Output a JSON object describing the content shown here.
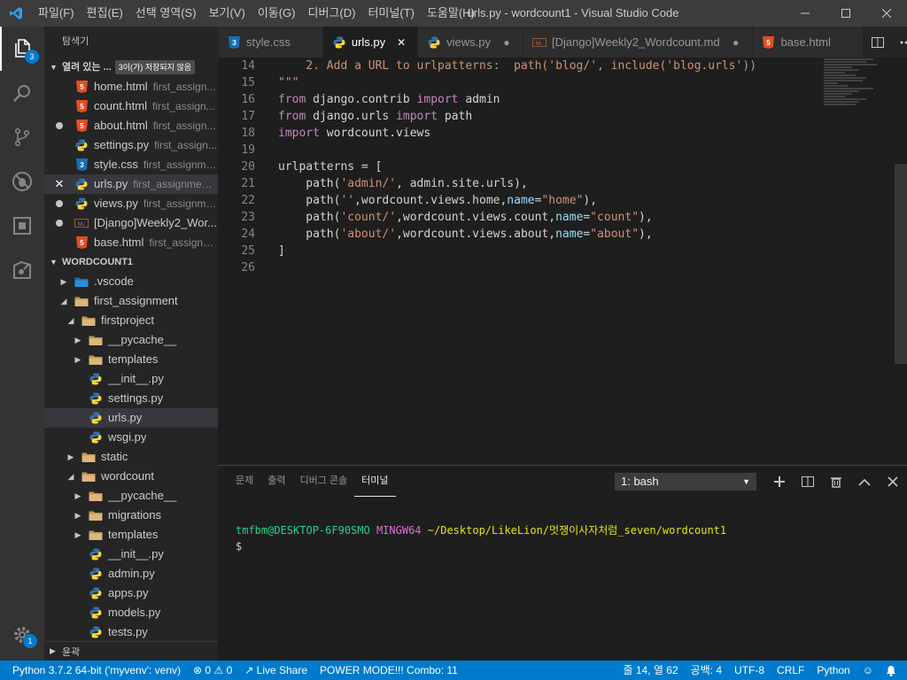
{
  "window": {
    "title": "urls.py - wordcount1 - Visual Studio Code"
  },
  "menu": [
    "파일(F)",
    "편집(E)",
    "선택 영역(S)",
    "보기(V)",
    "이동(G)",
    "디버그(D)",
    "터미널(T)",
    "도움말(H)"
  ],
  "activity": {
    "explorer_badge": "3",
    "settings_badge": "1"
  },
  "sidebar": {
    "title": "탐색기",
    "open_editors": {
      "header": "열려 있는 ...",
      "unsaved": "3이(가) 저장되지 않음",
      "items": [
        {
          "name": "home.html",
          "desc": "first_assign...",
          "icon": "html",
          "status": ""
        },
        {
          "name": "count.html",
          "desc": "first_assign...",
          "icon": "html",
          "status": ""
        },
        {
          "name": "about.html",
          "desc": "first_assign...",
          "icon": "html",
          "status": "dirty"
        },
        {
          "name": "settings.py",
          "desc": "first_assign...",
          "icon": "python",
          "status": ""
        },
        {
          "name": "style.css",
          "desc": "first_assignme...",
          "icon": "css",
          "status": ""
        },
        {
          "name": "urls.py",
          "desc": "first_assignment...",
          "icon": "python",
          "status": "close"
        },
        {
          "name": "views.py",
          "desc": "first_assignme...",
          "icon": "python",
          "status": "dirty"
        },
        {
          "name": "[Django]Weekly2_Wor...",
          "desc": "",
          "icon": "markdown",
          "status": "dirty"
        },
        {
          "name": "base.html",
          "desc": "first_assignm...",
          "icon": "html",
          "status": ""
        }
      ]
    },
    "workspace": {
      "header": "WORDCOUNT1",
      "items": [
        {
          "name": ".vscode",
          "kind": "folder-vscode",
          "depth": 0,
          "chev": "closed"
        },
        {
          "name": "first_assignment",
          "kind": "folder",
          "depth": 0,
          "chev": "open"
        },
        {
          "name": "firstproject",
          "kind": "folder",
          "depth": 1,
          "chev": "open"
        },
        {
          "name": "__pycache__",
          "kind": "folder",
          "depth": 2,
          "chev": "closed"
        },
        {
          "name": "templates",
          "kind": "folder",
          "depth": 2,
          "chev": "closed"
        },
        {
          "name": "__init__.py",
          "kind": "python",
          "depth": 2,
          "chev": ""
        },
        {
          "name": "settings.py",
          "kind": "python",
          "depth": 2,
          "chev": ""
        },
        {
          "name": "urls.py",
          "kind": "python",
          "depth": 2,
          "chev": "",
          "selected": true
        },
        {
          "name": "wsgi.py",
          "kind": "python",
          "depth": 2,
          "chev": ""
        },
        {
          "name": "static",
          "kind": "folder",
          "depth": 1,
          "chev": "closed"
        },
        {
          "name": "wordcount",
          "kind": "folder",
          "depth": 1,
          "chev": "open"
        },
        {
          "name": "__pycache__",
          "kind": "folder",
          "depth": 2,
          "chev": "closed"
        },
        {
          "name": "migrations",
          "kind": "folder",
          "depth": 2,
          "chev": "closed"
        },
        {
          "name": "templates",
          "kind": "folder",
          "depth": 2,
          "chev": "closed"
        },
        {
          "name": "__init__.py",
          "kind": "python",
          "depth": 2,
          "chev": ""
        },
        {
          "name": "admin.py",
          "kind": "python",
          "depth": 2,
          "chev": ""
        },
        {
          "name": "apps.py",
          "kind": "python",
          "depth": 2,
          "chev": ""
        },
        {
          "name": "models.py",
          "kind": "python",
          "depth": 2,
          "chev": ""
        },
        {
          "name": "tests.py",
          "kind": "python",
          "depth": 2,
          "chev": ""
        }
      ]
    },
    "outline": "윤곽"
  },
  "tabs": [
    {
      "label": "style.css",
      "icon": "css",
      "state": ""
    },
    {
      "label": "urls.py",
      "icon": "python",
      "state": "active"
    },
    {
      "label": "views.py",
      "icon": "python",
      "state": "dirty"
    },
    {
      "label": "[Django]Weekly2_Wordcount.md",
      "icon": "markdown",
      "state": "dirty"
    },
    {
      "label": "base.html",
      "icon": "html",
      "state": ""
    }
  ],
  "editor": {
    "lines": [
      {
        "n": "14",
        "tokens": [
          [
            "cmt",
            "    2. Add a URL to urlpatterns:  path('blog/', include('blog.urls'))"
          ]
        ]
      },
      {
        "n": "15",
        "tokens": [
          [
            "cmt",
            "\"\"\""
          ]
        ]
      },
      {
        "n": "16",
        "tokens": [
          [
            "kw",
            "from"
          ],
          [
            "",
            " django.contrib "
          ],
          [
            "kw",
            "import"
          ],
          [
            "",
            " admin"
          ]
        ]
      },
      {
        "n": "17",
        "tokens": [
          [
            "kw",
            "from"
          ],
          [
            "",
            " django.urls "
          ],
          [
            "kw",
            "import"
          ],
          [
            "",
            " path"
          ]
        ]
      },
      {
        "n": "18",
        "tokens": [
          [
            "kw",
            "import"
          ],
          [
            "",
            " wordcount.views"
          ]
        ]
      },
      {
        "n": "19",
        "tokens": []
      },
      {
        "n": "20",
        "tokens": [
          [
            "",
            "urlpatterns = ["
          ]
        ]
      },
      {
        "n": "21",
        "tokens": [
          [
            "",
            "    path("
          ],
          [
            "str",
            "'admin/'"
          ],
          [
            "",
            ", admin.site.urls),"
          ]
        ]
      },
      {
        "n": "22",
        "tokens": [
          [
            "",
            "    path("
          ],
          [
            "str",
            "''"
          ],
          [
            "",
            ",wordcount.views.home,"
          ],
          [
            "prm",
            "name"
          ],
          [
            "",
            "="
          ],
          [
            "str",
            "\"home\""
          ],
          [
            "",
            "),"
          ]
        ]
      },
      {
        "n": "23",
        "tokens": [
          [
            "",
            "    path("
          ],
          [
            "str",
            "'count/'"
          ],
          [
            "",
            ",wordcount.views.count,"
          ],
          [
            "prm",
            "name"
          ],
          [
            "",
            "="
          ],
          [
            "str",
            "\"count\""
          ],
          [
            "",
            "),"
          ]
        ]
      },
      {
        "n": "24",
        "tokens": [
          [
            "",
            "    path("
          ],
          [
            "str",
            "'about/'"
          ],
          [
            "",
            ",wordcount.views.about,"
          ],
          [
            "prm",
            "name"
          ],
          [
            "",
            "="
          ],
          [
            "str",
            "\"about\""
          ],
          [
            "",
            "),"
          ]
        ]
      },
      {
        "n": "25",
        "tokens": [
          [
            "",
            "]"
          ]
        ]
      },
      {
        "n": "26",
        "tokens": []
      }
    ]
  },
  "panel": {
    "tabs": [
      "문제",
      "출력",
      "디버그 콘솔",
      "터미널"
    ],
    "active_tab": "터미널",
    "terminal_select": "1: bash",
    "prompt_user": "tmfbm@DESKTOP-6F90SMO",
    "prompt_host": "MINGW64",
    "prompt_path": "~/Desktop/LikeLion/멋쟁이사자처럼_seven/wordcount1",
    "prompt_symbol": "$"
  },
  "statusbar": {
    "python": "Python 3.7.2 64-bit ('myvenv': venv)",
    "errors": "0",
    "warnings": "0",
    "live_share": "Live Share",
    "power_mode": "POWER MODE!!! Combo: 11",
    "position": "줄 14, 열 62",
    "spaces": "공백: 4",
    "encoding": "UTF-8",
    "eol": "CRLF",
    "language": "Python"
  },
  "colors": {
    "accent": "#007acc",
    "background": "#1e1e1e",
    "sidebar": "#252526"
  }
}
